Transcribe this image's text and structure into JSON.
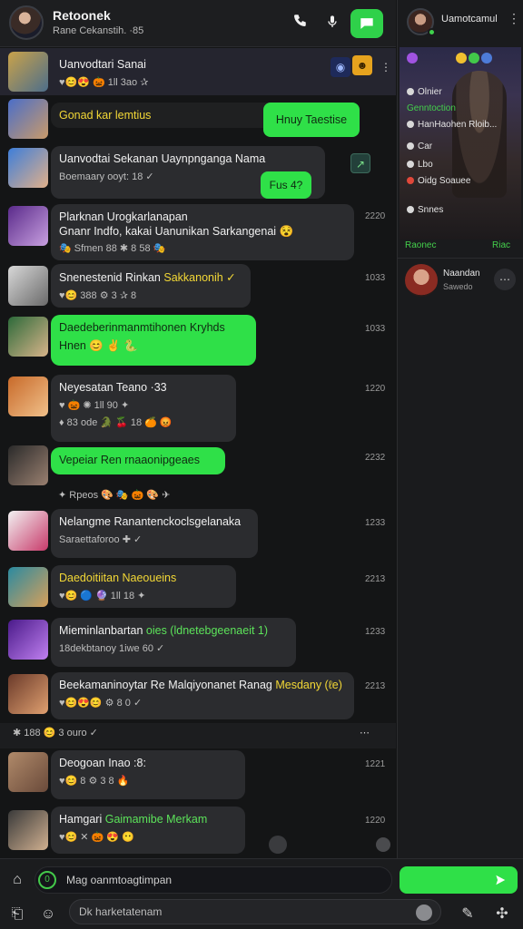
{
  "header": {
    "name": "Retoonek",
    "subtitle": "Rane Cekanstih. ·85",
    "call_icon": "phone-icon",
    "mic_icon": "mic-icon",
    "chat_icon": "chat-bubble-icon"
  },
  "messages": [
    {
      "title": "Uanvodtari Sanai",
      "meta": "♥😊😍 🎃 1ll 3ao ✰",
      "time": "",
      "green": false
    },
    {
      "title": "Gonad kar lemtius",
      "meta": "",
      "time": "",
      "green": false,
      "reply": "Hnuy Taestise"
    },
    {
      "title": "Uanvodtai Sekanan Uaynpnganga Nama",
      "meta": "Boemaary ooyt: 18 ✓",
      "time": "",
      "green": false,
      "reply": "Fus 4?"
    },
    {
      "title": "Plarknan Urogkarlanapan",
      "title2": "Gnanr Indfo, kakai Uanunikan Sarkangenai 😵",
      "meta": "🎭 Sfmen 88 ✱ 8 58 🎭",
      "time": "2220",
      "green": false
    },
    {
      "title": "Snenestenid Rinkan",
      "title_accent": "Sakkanonih ✓",
      "meta": "♥😊 388 ⚙ 3 ✰ 8",
      "time": "1033",
      "green": false
    },
    {
      "title": "Daedeberinmanmtihonen Kryhds",
      "title2": "Hnen 😊 ✌ 🐍",
      "meta": "",
      "time": "1033",
      "green": true
    },
    {
      "title": "Neyesatan Teano ·33",
      "meta": "♥ 🎃 ✺ 1ll 90 ✦",
      "meta2": "♦ 83 ode 🐊 🍒 18 🍊 😡",
      "time": "1220",
      "green": false
    },
    {
      "title": "Vepeiar Ren rnaaonipgeaes",
      "meta": "✦ Rpeos 🎨 🎭 🎃 🎨 ✈",
      "time": "2232",
      "green": true
    },
    {
      "title": "Nelangme Ranantenckoclsgelanaka",
      "meta": "Saraettaforoo ✚ ✓",
      "time": "1233",
      "green": false
    },
    {
      "title": "Daedoitiitan Naeoueins",
      "meta": "♥😊 🔵 🔮 1ll 18 ✦",
      "time": "2213",
      "green": false
    },
    {
      "title": "Mieminlanbartan",
      "title_accent": "oies (ldnetebgeenaeit 1)",
      "meta": "18dekbtanoy 1iwe 60 ✓",
      "time": "1233",
      "green": false
    },
    {
      "title": "Beekamaninoytar Re Malqiyonanet Ranag",
      "title_accent": "Mesdany (ℓe)",
      "meta": "♥😊😍😊 ⚙ 8 0 ✓",
      "time": "2213",
      "green": false
    },
    {
      "title": "",
      "meta": "✱ 188 😊 3 ouro ✓",
      "time": "",
      "green": false,
      "strip": true
    },
    {
      "title": "Deogoan Inao :8:",
      "meta": "♥😊 8 ⚙ 3 8 🔥",
      "time": "1221",
      "green": false
    },
    {
      "title": "Hamgari",
      "title_accent": "Gaimamibe Merkam",
      "meta": "♥😊 ✕ 🎃 😍 😶",
      "time": "1220",
      "green": false
    }
  ],
  "composer": {
    "input_text": "Mag oanmtoagtimpan",
    "search_text": "Dk harketatenam",
    "send_icon": "send-icon"
  },
  "right_panel": {
    "name": "Uamotcamul",
    "lines": [
      "Olnier",
      "Genntoction",
      "HanHaohen Rloib...",
      "Car",
      "Lbo",
      "Oidg Soauee",
      "Snnes"
    ],
    "footer_left": "Raonec",
    "footer_right": "Riac",
    "contact_name": "Naandan",
    "contact_sub": "Sawedo"
  },
  "colors": {
    "accent": "#2fe048",
    "background": "#141516",
    "bubble": "#2b2c2f"
  }
}
